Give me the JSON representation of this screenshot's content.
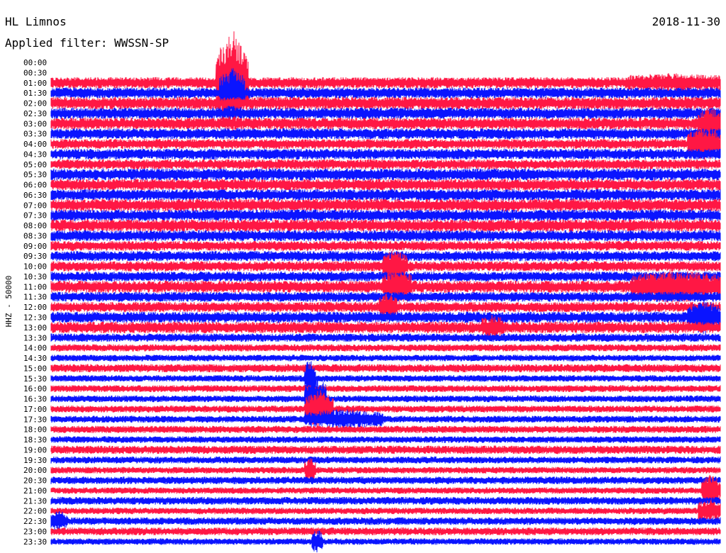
{
  "header": {
    "station": "HL Limnos",
    "date": "2018-11-30",
    "filter": "Applied filter: WWSSN-SP"
  },
  "chart_data": {
    "type": "line",
    "title": "HL Limnos",
    "ylabel": "HHZ - 50000",
    "row_labels": [
      "00:00",
      "00:30",
      "01:00",
      "01:30",
      "02:00",
      "02:30",
      "03:00",
      "03:30",
      "04:00",
      "04:30",
      "05:00",
      "05:30",
      "06:00",
      "06:30",
      "07:00",
      "07:30",
      "08:00",
      "08:30",
      "09:00",
      "09:30",
      "10:00",
      "10:30",
      "11:00",
      "11:30",
      "12:00",
      "12:30",
      "13:00",
      "13:30",
      "14:00",
      "14:30",
      "15:00",
      "15:30",
      "16:00",
      "16:30",
      "17:00",
      "17:30",
      "18:00",
      "18:30",
      "19:00",
      "19:30",
      "20:00",
      "20:30",
      "21:00",
      "21:30",
      "22:00",
      "22:30",
      "23:00",
      "23:30"
    ],
    "trace_colors": [
      "#ff1744",
      "#0a14ff"
    ],
    "rows_without_data": [
      "00:00",
      "00:30"
    ],
    "x_range_minutes": [
      0,
      30
    ]
  }
}
